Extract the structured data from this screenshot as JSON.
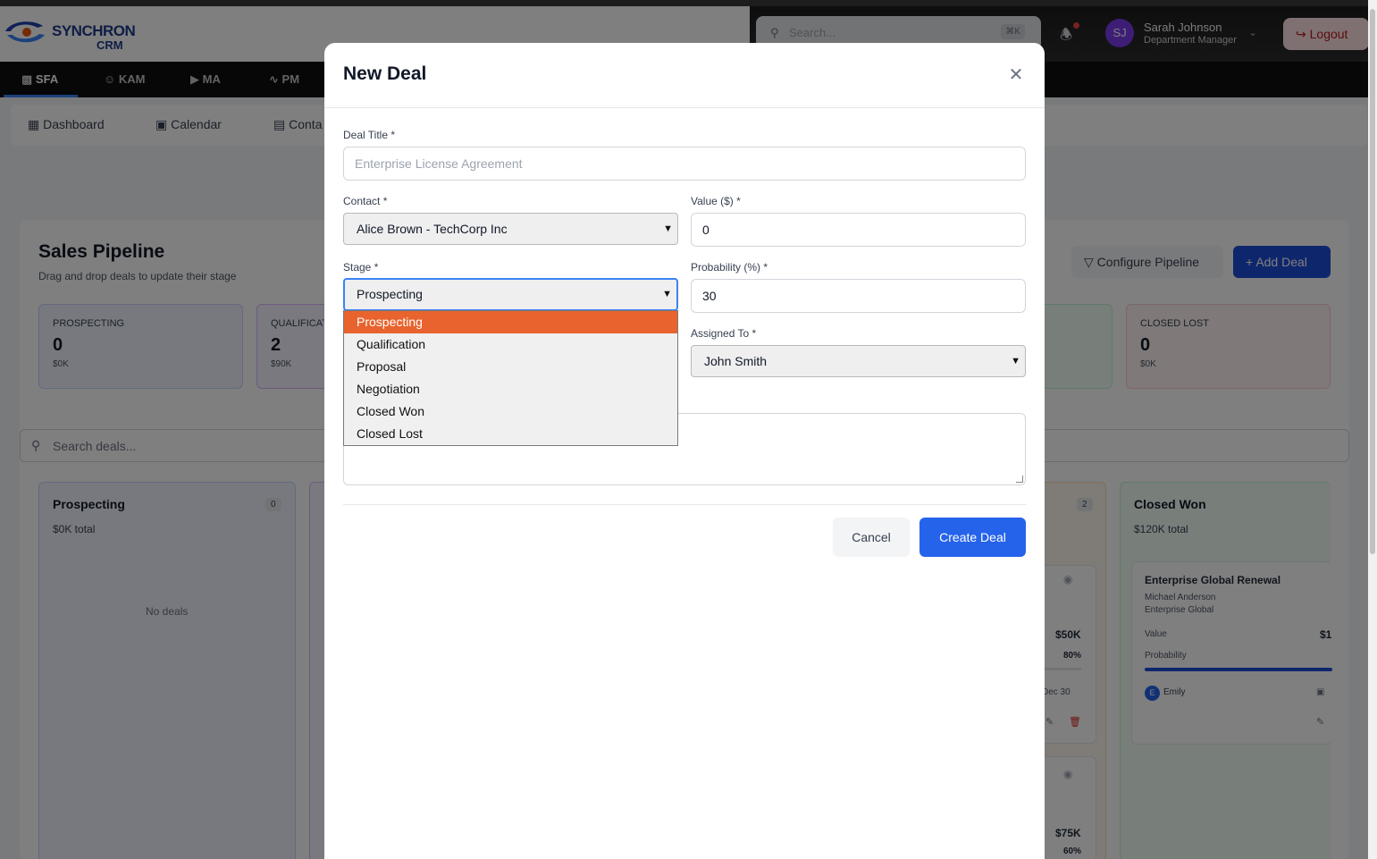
{
  "brand": {
    "name": "SYNCHRON",
    "sub": "CRM"
  },
  "header": {
    "search_placeholder": "Search...",
    "search_kbd": "⌘K",
    "user": {
      "initials": "SJ",
      "name": "Sarah Johnson",
      "role": "Department Manager"
    },
    "logout_label": "Logout"
  },
  "nav": [
    {
      "label": "SFA",
      "active": true
    },
    {
      "label": "KAM"
    },
    {
      "label": "MA"
    },
    {
      "label": "PM"
    }
  ],
  "subnav": [
    {
      "label": "Dashboard"
    },
    {
      "label": "Calendar"
    },
    {
      "label": "Conta"
    }
  ],
  "pipeline": {
    "title": "Sales Pipeline",
    "subtitle": "Drag and drop deals to update their stage",
    "configure_label": "Configure Pipeline",
    "add_label": "Add Deal",
    "search_placeholder": "Search deals..."
  },
  "stats": [
    {
      "label": "PROSPECTING",
      "count": "0",
      "amount": "$0K"
    },
    {
      "label": "QUALIFICAT",
      "count": "2",
      "amount": "$90K"
    },
    {
      "label": "CLOSED LOST",
      "count": "0",
      "amount": "$0K"
    }
  ],
  "columns": {
    "prospecting": {
      "title": "Prospecting",
      "total": "$0K total",
      "count": "0",
      "empty": "No deals"
    },
    "negotiation": {
      "count": "2",
      "card1": {
        "value": "$50K",
        "prob": "80%",
        "date": "Dec 30"
      },
      "card2": {
        "value": "$75K",
        "prob": "60%"
      }
    },
    "closed_won": {
      "title": "Closed Won",
      "total": "$120K total",
      "card": {
        "title": "Enterprise Global Renewal",
        "contact": "Michael Anderson",
        "company": "Enterprise Global",
        "value_label": "Value",
        "value": "$1",
        "prob_label": "Probability",
        "owner_initial": "E",
        "owner": "Emily"
      }
    }
  },
  "modal": {
    "title": "New Deal",
    "deal_title_label": "Deal Title *",
    "deal_title_placeholder": "Enterprise License Agreement",
    "contact_label": "Contact *",
    "contact_value": "Alice Brown - TechCorp Inc",
    "value_label": "Value ($) *",
    "value_value": "0",
    "stage_label": "Stage *",
    "stage_value": "Prospecting",
    "probability_label": "Probability (%) *",
    "probability_value": "30",
    "assigned_label": "Assigned To *",
    "assigned_value": "John Smith",
    "stage_options": [
      "Prospecting",
      "Qualification",
      "Proposal",
      "Negotiation",
      "Closed Won",
      "Closed Lost"
    ],
    "cancel_label": "Cancel",
    "create_label": "Create Deal"
  },
  "colors": {
    "primary": "#2563eb",
    "selected_option": "#e8632d",
    "danger": "#b91c1c"
  }
}
